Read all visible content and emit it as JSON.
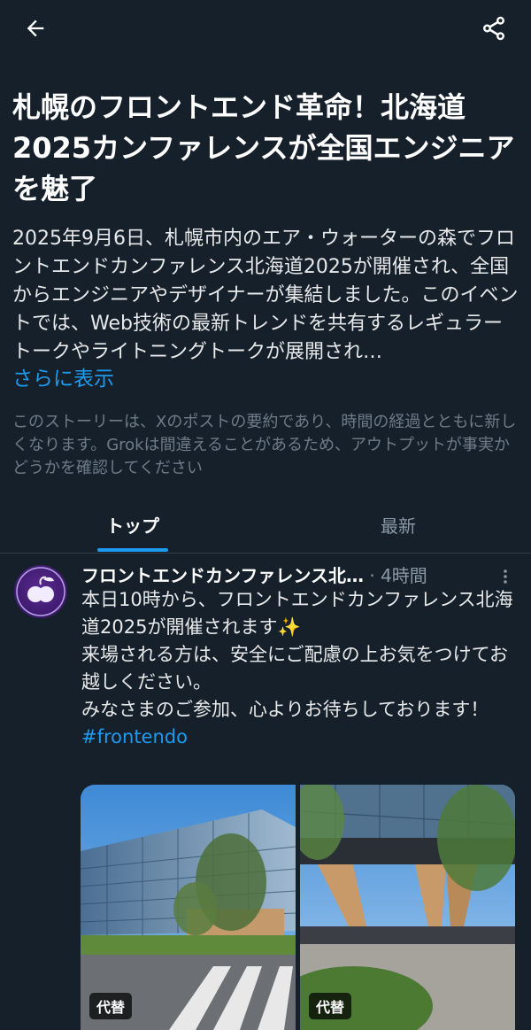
{
  "header": {
    "back_icon": "arrow-left-icon",
    "share_icon": "share-icon"
  },
  "story": {
    "title": "札幌のフロントエンド革命！北海道2025カンファレンスが全国エンジニアを魅了",
    "summary": "2025年9月6日、札幌市内のエア・ウォーターの森でフロントエンドカンファレンス北海道2025が開催され、全国からエンジニアやデザイナーが集結しました。このイベントでは、Web技術の最新トレンドを共有するレギュラートークやライトニングトークが展開され…",
    "show_more": "さらに表示",
    "disclaimer": "このストーリーは、Xのポストの要約であり、時間の経過とともに新しくなります。Grokは間違えることがあるため、アウトプットが事実かどうかを確認してください"
  },
  "tabs": [
    {
      "label": "トップ",
      "selected": true
    },
    {
      "label": "最新",
      "selected": false
    }
  ],
  "post": {
    "author": "フロントエンドカンファレンス北…",
    "meta": " · 4時間",
    "body_lines": [
      "本日10時から、フロントエンドカンファレンス北海道2025が開催されます✨",
      "来場される方は、安全にご配慮の上お気をつけてお越しください。",
      "みなさまのご参加、心よりお待ちしております！"
    ],
    "hashtag": "#frontendo",
    "media": [
      {
        "alt_badge": "代替"
      },
      {
        "alt_badge": "代替"
      }
    ]
  },
  "colors": {
    "background": "#15202b",
    "accent": "#1d9bf0",
    "text": "#e7e9ea",
    "muted": "#8b98a5"
  }
}
